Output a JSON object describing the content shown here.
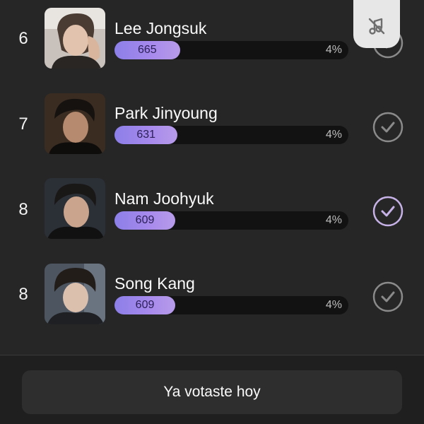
{
  "ranking": [
    {
      "rank": "6",
      "name": "Lee Jongsuk",
      "votes": "665",
      "percent": "4%",
      "share": 0.28,
      "voted": false,
      "avatar_icon": "person-photo-icon"
    },
    {
      "rank": "7",
      "name": "Park Jinyoung",
      "votes": "631",
      "percent": "4%",
      "share": 0.27,
      "voted": false,
      "avatar_icon": "person-photo-icon"
    },
    {
      "rank": "8",
      "name": "Nam Joohyuk",
      "votes": "609",
      "percent": "4%",
      "share": 0.26,
      "voted": true,
      "avatar_icon": "person-photo-icon"
    },
    {
      "rank": "8",
      "name": "Song Kang",
      "votes": "609",
      "percent": "4%",
      "share": 0.26,
      "voted": false,
      "avatar_icon": "person-photo-icon"
    }
  ],
  "floating_button": {
    "icon": "music-off-icon"
  },
  "footer": {
    "button_label": "Ya votaste hoy"
  },
  "colors": {
    "background": "#262626",
    "bar_gradient_start": "#8c7fe8",
    "bar_gradient_end": "#b79be9",
    "check_default": "#8a8a8a",
    "check_selected": "#c6b2e6"
  }
}
